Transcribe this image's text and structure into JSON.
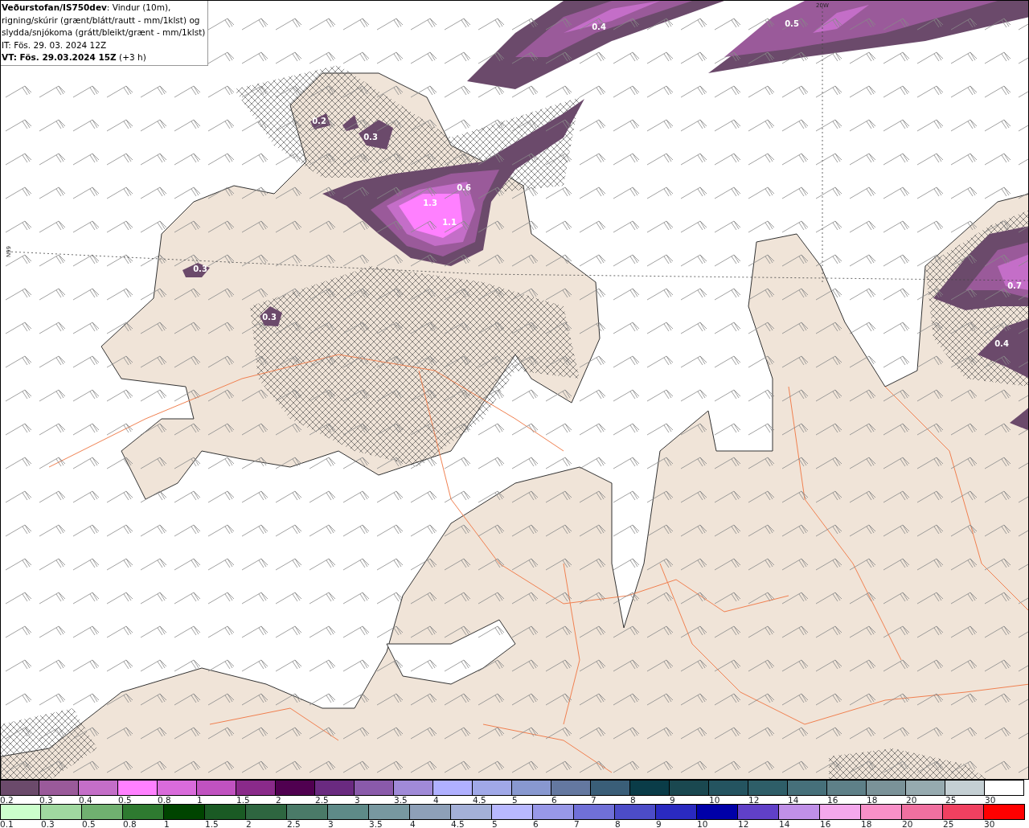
{
  "header": {
    "lines": [
      "**Veðurstofan/IS750dev**: Vindur (10m),",
      "rigning/skúrir (grænt/blátt/rautt - mm/1klst) og",
      "slydda/snjókoma (grátt/bleikt/grænt - mm/1klst)",
      "IT: Fös. 29. 03. 2024 12Z",
      "**VT: Fös. 29.03.2024 15Z** (+3 h)"
    ]
  },
  "map": {
    "grid_labels": [
      {
        "kind": "longitude",
        "text": "20W"
      },
      {
        "kind": "latitude",
        "text": "66N"
      }
    ],
    "contour_labels": [
      "0.4",
      "0.5",
      "0.2",
      "0.3",
      "0.6",
      "1.3",
      "1.1",
      "0.3",
      "0.3",
      "0.7",
      "0.4"
    ]
  },
  "legend": {
    "rows": [
      {
        "items": [
          {
            "label": "0.2",
            "color": "#6b4a6b"
          },
          {
            "label": "0.3",
            "color": "#9a5a9a"
          },
          {
            "label": "0.4",
            "color": "#c46ec8"
          },
          {
            "label": "0.5",
            "color": "#ff80ff"
          },
          {
            "label": "0.8",
            "color": "#d96bdb"
          },
          {
            "label": "1",
            "color": "#c052c0"
          },
          {
            "label": "1.5",
            "color": "#8a2a8a"
          },
          {
            "label": "2",
            "color": "#500050"
          },
          {
            "label": "2.5",
            "color": "#6a2a80"
          },
          {
            "label": "3",
            "color": "#8a5aaa"
          },
          {
            "label": "3.5",
            "color": "#a08ad8"
          },
          {
            "label": "4",
            "color": "#b0b0ff"
          },
          {
            "label": "4.5",
            "color": "#a0a8e8"
          },
          {
            "label": "5",
            "color": "#8898d0"
          },
          {
            "label": "6",
            "color": "#6478a0"
          },
          {
            "label": "7",
            "color": "#3a5e78"
          },
          {
            "label": "8",
            "color": "#0a3c48"
          },
          {
            "label": "9",
            "color": "#1a4850"
          },
          {
            "label": "10",
            "color": "#245460"
          },
          {
            "label": "12",
            "color": "#2e5e68"
          },
          {
            "label": "14",
            "color": "#46707a"
          },
          {
            "label": "16",
            "color": "#5e8088"
          },
          {
            "label": "18",
            "color": "#7a9298"
          },
          {
            "label": "20",
            "color": "#96aaaf"
          },
          {
            "label": "25",
            "color": "#c4cfd3"
          },
          {
            "label": "30",
            "color": "#ffffff"
          }
        ]
      },
      {
        "items": [
          {
            "label": "0.1",
            "color": "#ccffcc"
          },
          {
            "label": "0.3",
            "color": "#a0d8a0"
          },
          {
            "label": "0.5",
            "color": "#70b070"
          },
          {
            "label": "0.8",
            "color": "#2e7a30"
          },
          {
            "label": "1",
            "color": "#004400"
          },
          {
            "label": "1.5",
            "color": "#1a5a24"
          },
          {
            "label": "2",
            "color": "#2e6640"
          },
          {
            "label": "2.5",
            "color": "#4a7a68"
          },
          {
            "label": "3",
            "color": "#5e8a88"
          },
          {
            "label": "3.5",
            "color": "#7898a0"
          },
          {
            "label": "4",
            "color": "#8ea0b8"
          },
          {
            "label": "4.5",
            "color": "#a4b0d8"
          },
          {
            "label": "5",
            "color": "#b8b8ff"
          },
          {
            "label": "6",
            "color": "#9898e8"
          },
          {
            "label": "7",
            "color": "#7070d8"
          },
          {
            "label": "8",
            "color": "#4c4cc8"
          },
          {
            "label": "9",
            "color": "#2a2ac0"
          },
          {
            "label": "10",
            "color": "#0000a8"
          },
          {
            "label": "12",
            "color": "#6040c8"
          },
          {
            "label": "14",
            "color": "#c090e8"
          },
          {
            "label": "16",
            "color": "#f4a8ec"
          },
          {
            "label": "18",
            "color": "#f890c8"
          },
          {
            "label": "20",
            "color": "#f070a0"
          },
          {
            "label": "25",
            "color": "#f04060"
          },
          {
            "label": "30",
            "color": "#ff0000"
          }
        ]
      }
    ]
  }
}
